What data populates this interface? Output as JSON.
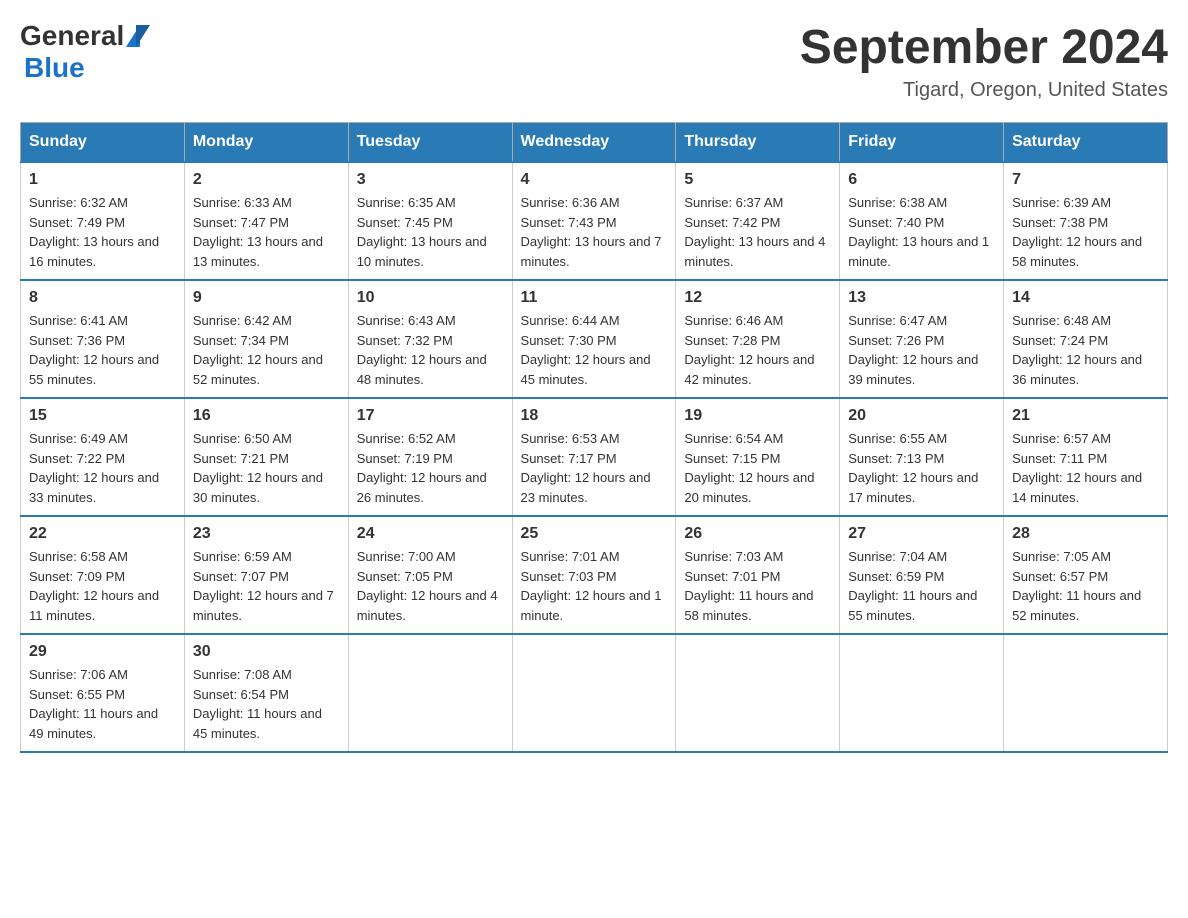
{
  "header": {
    "logo_general": "General",
    "logo_blue": "Blue",
    "month_title": "September 2024",
    "location": "Tigard, Oregon, United States"
  },
  "days_of_week": [
    "Sunday",
    "Monday",
    "Tuesday",
    "Wednesday",
    "Thursday",
    "Friday",
    "Saturday"
  ],
  "weeks": [
    [
      {
        "day": "1",
        "sunrise": "6:32 AM",
        "sunset": "7:49 PM",
        "daylight": "13 hours and 16 minutes."
      },
      {
        "day": "2",
        "sunrise": "6:33 AM",
        "sunset": "7:47 PM",
        "daylight": "13 hours and 13 minutes."
      },
      {
        "day": "3",
        "sunrise": "6:35 AM",
        "sunset": "7:45 PM",
        "daylight": "13 hours and 10 minutes."
      },
      {
        "day": "4",
        "sunrise": "6:36 AM",
        "sunset": "7:43 PM",
        "daylight": "13 hours and 7 minutes."
      },
      {
        "day": "5",
        "sunrise": "6:37 AM",
        "sunset": "7:42 PM",
        "daylight": "13 hours and 4 minutes."
      },
      {
        "day": "6",
        "sunrise": "6:38 AM",
        "sunset": "7:40 PM",
        "daylight": "13 hours and 1 minute."
      },
      {
        "day": "7",
        "sunrise": "6:39 AM",
        "sunset": "7:38 PM",
        "daylight": "12 hours and 58 minutes."
      }
    ],
    [
      {
        "day": "8",
        "sunrise": "6:41 AM",
        "sunset": "7:36 PM",
        "daylight": "12 hours and 55 minutes."
      },
      {
        "day": "9",
        "sunrise": "6:42 AM",
        "sunset": "7:34 PM",
        "daylight": "12 hours and 52 minutes."
      },
      {
        "day": "10",
        "sunrise": "6:43 AM",
        "sunset": "7:32 PM",
        "daylight": "12 hours and 48 minutes."
      },
      {
        "day": "11",
        "sunrise": "6:44 AM",
        "sunset": "7:30 PM",
        "daylight": "12 hours and 45 minutes."
      },
      {
        "day": "12",
        "sunrise": "6:46 AM",
        "sunset": "7:28 PM",
        "daylight": "12 hours and 42 minutes."
      },
      {
        "day": "13",
        "sunrise": "6:47 AM",
        "sunset": "7:26 PM",
        "daylight": "12 hours and 39 minutes."
      },
      {
        "day": "14",
        "sunrise": "6:48 AM",
        "sunset": "7:24 PM",
        "daylight": "12 hours and 36 minutes."
      }
    ],
    [
      {
        "day": "15",
        "sunrise": "6:49 AM",
        "sunset": "7:22 PM",
        "daylight": "12 hours and 33 minutes."
      },
      {
        "day": "16",
        "sunrise": "6:50 AM",
        "sunset": "7:21 PM",
        "daylight": "12 hours and 30 minutes."
      },
      {
        "day": "17",
        "sunrise": "6:52 AM",
        "sunset": "7:19 PM",
        "daylight": "12 hours and 26 minutes."
      },
      {
        "day": "18",
        "sunrise": "6:53 AM",
        "sunset": "7:17 PM",
        "daylight": "12 hours and 23 minutes."
      },
      {
        "day": "19",
        "sunrise": "6:54 AM",
        "sunset": "7:15 PM",
        "daylight": "12 hours and 20 minutes."
      },
      {
        "day": "20",
        "sunrise": "6:55 AM",
        "sunset": "7:13 PM",
        "daylight": "12 hours and 17 minutes."
      },
      {
        "day": "21",
        "sunrise": "6:57 AM",
        "sunset": "7:11 PM",
        "daylight": "12 hours and 14 minutes."
      }
    ],
    [
      {
        "day": "22",
        "sunrise": "6:58 AM",
        "sunset": "7:09 PM",
        "daylight": "12 hours and 11 minutes."
      },
      {
        "day": "23",
        "sunrise": "6:59 AM",
        "sunset": "7:07 PM",
        "daylight": "12 hours and 7 minutes."
      },
      {
        "day": "24",
        "sunrise": "7:00 AM",
        "sunset": "7:05 PM",
        "daylight": "12 hours and 4 minutes."
      },
      {
        "day": "25",
        "sunrise": "7:01 AM",
        "sunset": "7:03 PM",
        "daylight": "12 hours and 1 minute."
      },
      {
        "day": "26",
        "sunrise": "7:03 AM",
        "sunset": "7:01 PM",
        "daylight": "11 hours and 58 minutes."
      },
      {
        "day": "27",
        "sunrise": "7:04 AM",
        "sunset": "6:59 PM",
        "daylight": "11 hours and 55 minutes."
      },
      {
        "day": "28",
        "sunrise": "7:05 AM",
        "sunset": "6:57 PM",
        "daylight": "11 hours and 52 minutes."
      }
    ],
    [
      {
        "day": "29",
        "sunrise": "7:06 AM",
        "sunset": "6:55 PM",
        "daylight": "11 hours and 49 minutes."
      },
      {
        "day": "30",
        "sunrise": "7:08 AM",
        "sunset": "6:54 PM",
        "daylight": "11 hours and 45 minutes."
      },
      null,
      null,
      null,
      null,
      null
    ]
  ]
}
